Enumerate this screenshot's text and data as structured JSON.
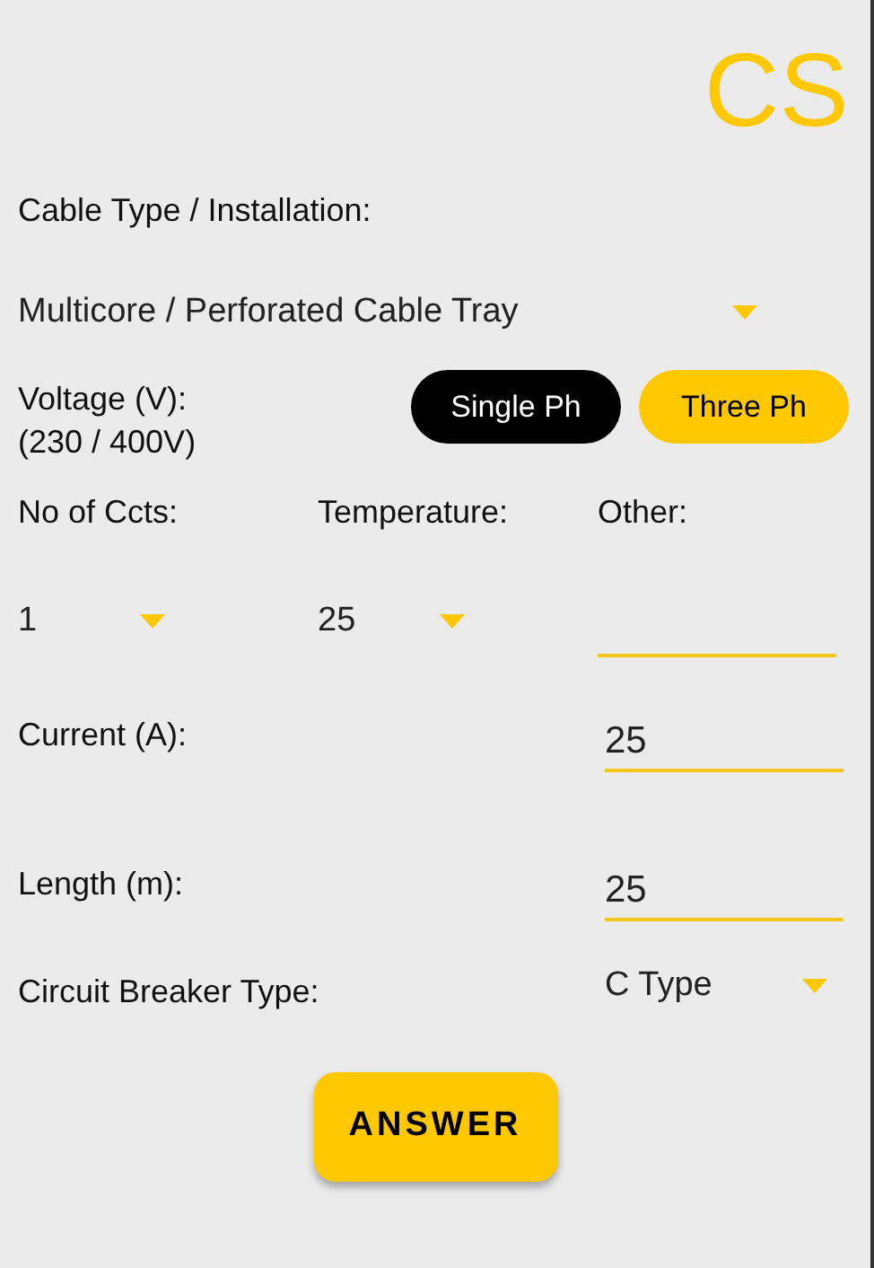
{
  "logo": "CS",
  "cable": {
    "label": "Cable Type / Installation:",
    "value": "Multicore / Perforated Cable Tray"
  },
  "voltage": {
    "label": "Voltage (V):",
    "sublabel": "(230 / 400V)",
    "phases": [
      {
        "label": "Single Ph",
        "selected": true
      },
      {
        "label": "Three Ph",
        "selected": false
      }
    ]
  },
  "columns": [
    {
      "kind": "dropdown",
      "label": "No of Ccts:",
      "value": "1"
    },
    {
      "kind": "dropdown",
      "label": "Temperature:",
      "value": "25"
    },
    {
      "kind": "input",
      "label": "Other:"
    }
  ],
  "fields": [
    {
      "kind": "input",
      "label": "Current (A):",
      "value": "25"
    },
    {
      "kind": "input",
      "label": "Length (m):",
      "value": "25"
    },
    {
      "kind": "dropdown",
      "label": "Circuit Breaker Type:",
      "value": "C Type"
    }
  ],
  "answer_button": "ANSWER"
}
